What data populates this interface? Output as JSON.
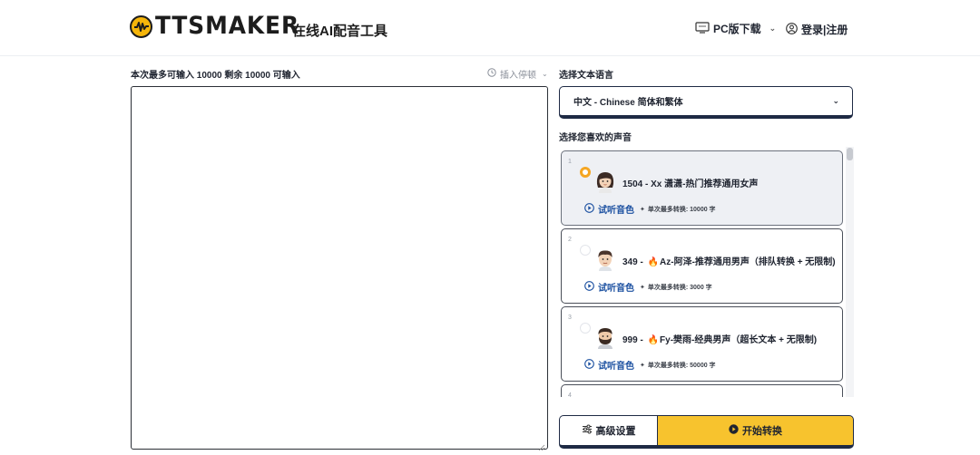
{
  "header": {
    "brand": "TTSMAKER",
    "tagline": "在线AI配音工具",
    "pc_download": "PC版下载",
    "login": "登录|注册",
    "brand_color": "#f5b50a"
  },
  "editor": {
    "char_info": "本次最多可输入 10000 剩余 10000 可输入",
    "insert_pause": "插入停顿",
    "text_value": ""
  },
  "language": {
    "label": "选择文本语言",
    "selected": "中文 - Chinese 简体和繁体"
  },
  "voices": {
    "label": "选择您喜欢的声音",
    "items": [
      {
        "index": "1",
        "id_prefix": "1504 - ",
        "hot": false,
        "name": "Xx 潇潇-热门推荐通用女声",
        "preview": "试听音色",
        "limit": "单次最多转换: 10000 字",
        "selected": true,
        "avatar": "female-avatar"
      },
      {
        "index": "2",
        "id_prefix": "349 - ",
        "hot": true,
        "name": "Az-阿泽-推荐通用男声（排队转换 + 无限制)",
        "preview": "试听音色",
        "limit": "单次最多转换: 3000 字",
        "selected": false,
        "avatar": "male-avatar"
      },
      {
        "index": "3",
        "id_prefix": "999 - ",
        "hot": true,
        "name": "Fy-樊雨-经典男声（超长文本 + 无限制)",
        "preview": "试听音色",
        "limit": "单次最多转换: 50000 字",
        "selected": false,
        "avatar": "bearded-avatar"
      },
      {
        "index": "4"
      }
    ]
  },
  "actions": {
    "advanced": "高级设置",
    "start": "开始转换",
    "start_color": "#f7c32e"
  }
}
